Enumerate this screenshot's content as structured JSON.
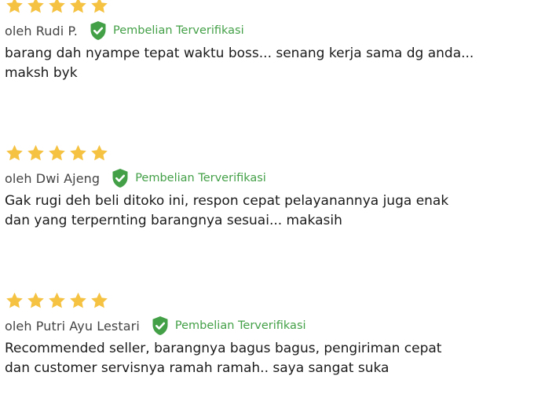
{
  "colors": {
    "star": "#f5c242",
    "verified_green": "#43a047",
    "text": "#1a1a1a",
    "author": "#444444"
  },
  "icons": {
    "star": "star-icon",
    "verified": "shield-check-icon"
  },
  "reviews": [
    {
      "rating": 5,
      "author": "oleh Rudi P.",
      "verified_label": "Pembelian Terverifikasi",
      "text": "barang dah nyampe tepat waktu boss... senang kerja sama dg anda...\nmaksh byk"
    },
    {
      "rating": 5,
      "author": "oleh Dwi Ajeng",
      "verified_label": "Pembelian Terverifikasi",
      "text": "Gak rugi deh beli ditoko ini, respon cepat pelayanannya juga enak\ndan yang terpernting barangnya sesuai... makasih"
    },
    {
      "rating": 5,
      "author": "oleh Putri Ayu Lestari",
      "verified_label": "Pembelian Terverifikasi",
      "text": "Recommended seller, barangnya bagus bagus, pengiriman cepat\ndan customer servisnya ramah ramah.. saya sangat suka"
    }
  ]
}
